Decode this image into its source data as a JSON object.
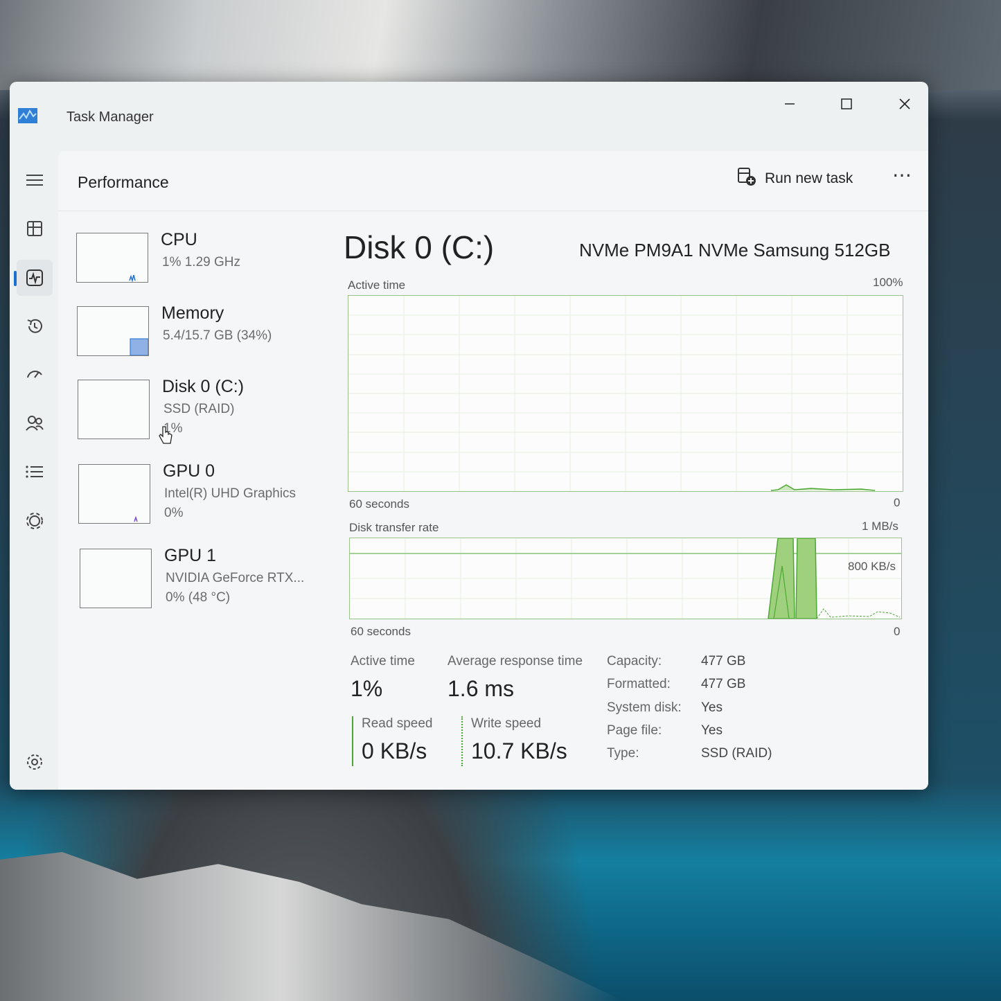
{
  "window": {
    "title": "Task Manager"
  },
  "header": {
    "page_title": "Performance",
    "run_new_task": "Run new task"
  },
  "sidebar": {
    "items": [
      {
        "name": "CPU",
        "line1": "1%  1.29 GHz",
        "line2": ""
      },
      {
        "name": "Memory",
        "line1": "5.4/15.7 GB (34%)",
        "line2": ""
      },
      {
        "name": "Disk 0 (C:)",
        "line1": "SSD (RAID)",
        "line2": "1%"
      },
      {
        "name": "GPU 0",
        "line1": "Intel(R) UHD Graphics",
        "line2": "0%"
      },
      {
        "name": "GPU 1",
        "line1": "NVIDIA GeForce RTX...",
        "line2": "0%  (48 °C)"
      }
    ]
  },
  "detail": {
    "title": "Disk 0 (C:)",
    "model": "NVMe PM9A1 NVMe Samsung 512GB",
    "active_graph": {
      "label": "Active time",
      "max": "100%",
      "time_span": "60 seconds",
      "min": "0"
    },
    "transfer_graph": {
      "label": "Disk transfer rate",
      "max": "1 MB/s",
      "mid": "800 KB/s",
      "time_span": "60 seconds",
      "min": "0"
    },
    "stats": {
      "active_time_label": "Active time",
      "active_time_value": "1%",
      "avg_response_label": "Average response time",
      "avg_response_value": "1.6 ms",
      "read_label": "Read speed",
      "read_value": "0 KB/s",
      "write_label": "Write speed",
      "write_value": "10.7 KB/s"
    },
    "properties": [
      {
        "key": "Capacity:",
        "value": "477 GB"
      },
      {
        "key": "Formatted:",
        "value": "477 GB"
      },
      {
        "key": "System disk:",
        "value": "Yes"
      },
      {
        "key": "Page file:",
        "value": "Yes"
      },
      {
        "key": "Type:",
        "value": "SSD (RAID)"
      }
    ]
  },
  "colors": {
    "disk_accent": "#4ca832",
    "disk_fill": "#9fd07e",
    "cpu_line": "#1a6fd1",
    "memory_fill": "#8fb1e6",
    "gpu_line": "#7a4bd6"
  }
}
